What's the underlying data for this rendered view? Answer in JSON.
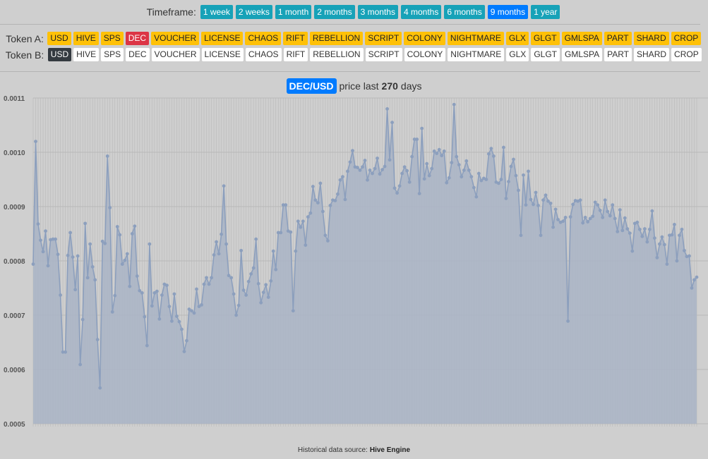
{
  "timeframe": {
    "label": "Timeframe:",
    "options": [
      "1 week",
      "2 weeks",
      "1 month",
      "2 months",
      "3 months",
      "4 months",
      "6 months",
      "9 months",
      "1 year"
    ],
    "active": "9 months"
  },
  "token_a": {
    "label": "Token A:",
    "options": [
      "USD",
      "HIVE",
      "SPS",
      "DEC",
      "VOUCHER",
      "LICENSE",
      "CHAOS",
      "RIFT",
      "REBELLION",
      "SCRIPT",
      "COLONY",
      "NIGHTMARE",
      "GLX",
      "GLGT",
      "GMLSPA",
      "PART",
      "SHARD",
      "CROP"
    ],
    "selected": "DEC"
  },
  "token_b": {
    "label": "Token B:",
    "options": [
      "USD",
      "HIVE",
      "SPS",
      "DEC",
      "VOUCHER",
      "LICENSE",
      "CHAOS",
      "RIFT",
      "REBELLION",
      "SCRIPT",
      "COLONY",
      "NIGHTMARE",
      "GLX",
      "GLGT",
      "GMLSPA",
      "PART",
      "SHARD",
      "CROP"
    ],
    "selected": "USD"
  },
  "title": {
    "pair": "DEC/USD",
    "prefix": "price last",
    "days": "270",
    "suffix": "days"
  },
  "footer": {
    "text": "Historical data source:",
    "source": "Hive Engine"
  },
  "colors": {
    "line": "#8c9fbd",
    "fill": "#a9b4c6",
    "grid": "#b8b8b8",
    "active_timeframe": "#007bff",
    "timeframe": "#17a2b8",
    "token_a": "#ffc107",
    "token_a_selected": "#dc3545",
    "token_b_selected": "#343a40"
  },
  "chart_data": {
    "type": "area",
    "title": "",
    "xlabel": "",
    "ylabel": "",
    "ylim": [
      0.0005,
      0.0011
    ],
    "y_ticks": [
      "0.0005",
      "0.0006",
      "0.0007",
      "0.0008",
      "0.0009",
      "0.0010",
      "0.0011"
    ],
    "grid": true,
    "legend": "none",
    "series": [
      {
        "values": [
          0.000794,
          0.00102,
          0.000868,
          0.000838,
          0.000817,
          0.000855,
          0.000791,
          0.000839,
          0.00084,
          0.00084,
          0.000812,
          0.000737,
          0.000632,
          0.000632,
          0.00081,
          0.000852,
          0.000807,
          0.000747,
          0.000809,
          0.000609,
          0.000692,
          0.000869,
          0.000769,
          0.000831,
          0.000789,
          0.000765,
          0.000655,
          0.000566,
          0.000836,
          0.000832,
          0.000993,
          0.000898,
          0.000706,
          0.000736,
          0.000863,
          0.000848,
          0.000794,
          0.000801,
          0.000813,
          0.000753,
          0.00085,
          0.000864,
          0.000772,
          0.000745,
          0.000741,
          0.000697,
          0.000644,
          0.000831,
          0.000717,
          0.000741,
          0.000744,
          0.000693,
          0.000737,
          0.000757,
          0.000755,
          0.000716,
          0.000689,
          0.000739,
          0.000698,
          0.000688,
          0.000674,
          0.000633,
          0.000653,
          0.000711,
          0.000708,
          0.000704,
          0.000748,
          0.000716,
          0.000719,
          0.000757,
          0.000769,
          0.000757,
          0.000769,
          0.000811,
          0.000835,
          0.000813,
          0.000849,
          0.000938,
          0.000831,
          0.000773,
          0.000769,
          0.000739,
          0.0007,
          0.000718,
          0.000819,
          0.000746,
          0.000737,
          0.000762,
          0.000776,
          0.000787,
          0.00084,
          0.000758,
          0.000723,
          0.000742,
          0.000756,
          0.000733,
          0.000763,
          0.000818,
          0.000784,
          0.000852,
          0.000852,
          0.000903,
          0.000903,
          0.000855,
          0.000853,
          0.000708,
          0.000818,
          0.000873,
          0.000862,
          0.000873,
          0.000829,
          0.000881,
          0.000888,
          0.000937,
          0.000912,
          0.000907,
          0.000943,
          0.000891,
          0.000847,
          0.000837,
          0.000902,
          0.000912,
          0.000911,
          0.000923,
          0.000949,
          0.000955,
          0.000913,
          0.000965,
          0.000982,
          0.001003,
          0.000973,
          0.000972,
          0.000967,
          0.000973,
          0.000985,
          0.000949,
          0.000967,
          0.000961,
          0.00097,
          0.000989,
          0.00096,
          0.000968,
          0.000974,
          0.00108,
          0.000986,
          0.001055,
          0.000934,
          0.000925,
          0.000938,
          0.000961,
          0.000973,
          0.000966,
          0.000945,
          0.000992,
          0.001024,
          0.001024,
          0.000924,
          0.001044,
          0.000951,
          0.000979,
          0.000957,
          0.00097,
          0.001002,
          0.000998,
          0.001005,
          0.000994,
          0.001002,
          0.000944,
          0.000953,
          0.000981,
          0.001088,
          0.000992,
          0.000977,
          0.000955,
          0.000967,
          0.000984,
          0.000967,
          0.000955,
          0.000935,
          0.000918,
          0.000961,
          0.000948,
          0.000952,
          0.00095,
          0.000997,
          0.001007,
          0.000993,
          0.000945,
          0.000943,
          0.00095,
          0.001009,
          0.000915,
          0.000946,
          0.000974,
          0.000987,
          0.000957,
          0.00093,
          0.000847,
          0.000958,
          0.000903,
          0.000965,
          0.000913,
          0.000904,
          0.000926,
          0.000902,
          0.000847,
          0.000912,
          0.000921,
          0.00091,
          0.000906,
          0.000862,
          0.000895,
          0.000876,
          0.000871,
          0.000873,
          0.00088,
          0.000689,
          0.000881,
          0.000904,
          0.000911,
          0.00091,
          0.000912,
          0.00087,
          0.00088,
          0.000872,
          0.000878,
          0.000882,
          0.000908,
          0.000903,
          0.000893,
          0.00088,
          0.000912,
          0.000891,
          0.000883,
          0.000903,
          0.000878,
          0.000854,
          0.000894,
          0.000856,
          0.000879,
          0.000859,
          0.000851,
          0.000818,
          0.000869,
          0.000871,
          0.000858,
          0.000845,
          0.000859,
          0.000835,
          0.000858,
          0.000892,
          0.000842,
          0.000806,
          0.000831,
          0.000844,
          0.00083,
          0.000794,
          0.000847,
          0.000848,
          0.000867,
          0.0008,
          0.000847,
          0.000858,
          0.000819,
          0.000808,
          0.000809,
          0.00075,
          0.000765,
          0.00077
        ]
      }
    ]
  }
}
